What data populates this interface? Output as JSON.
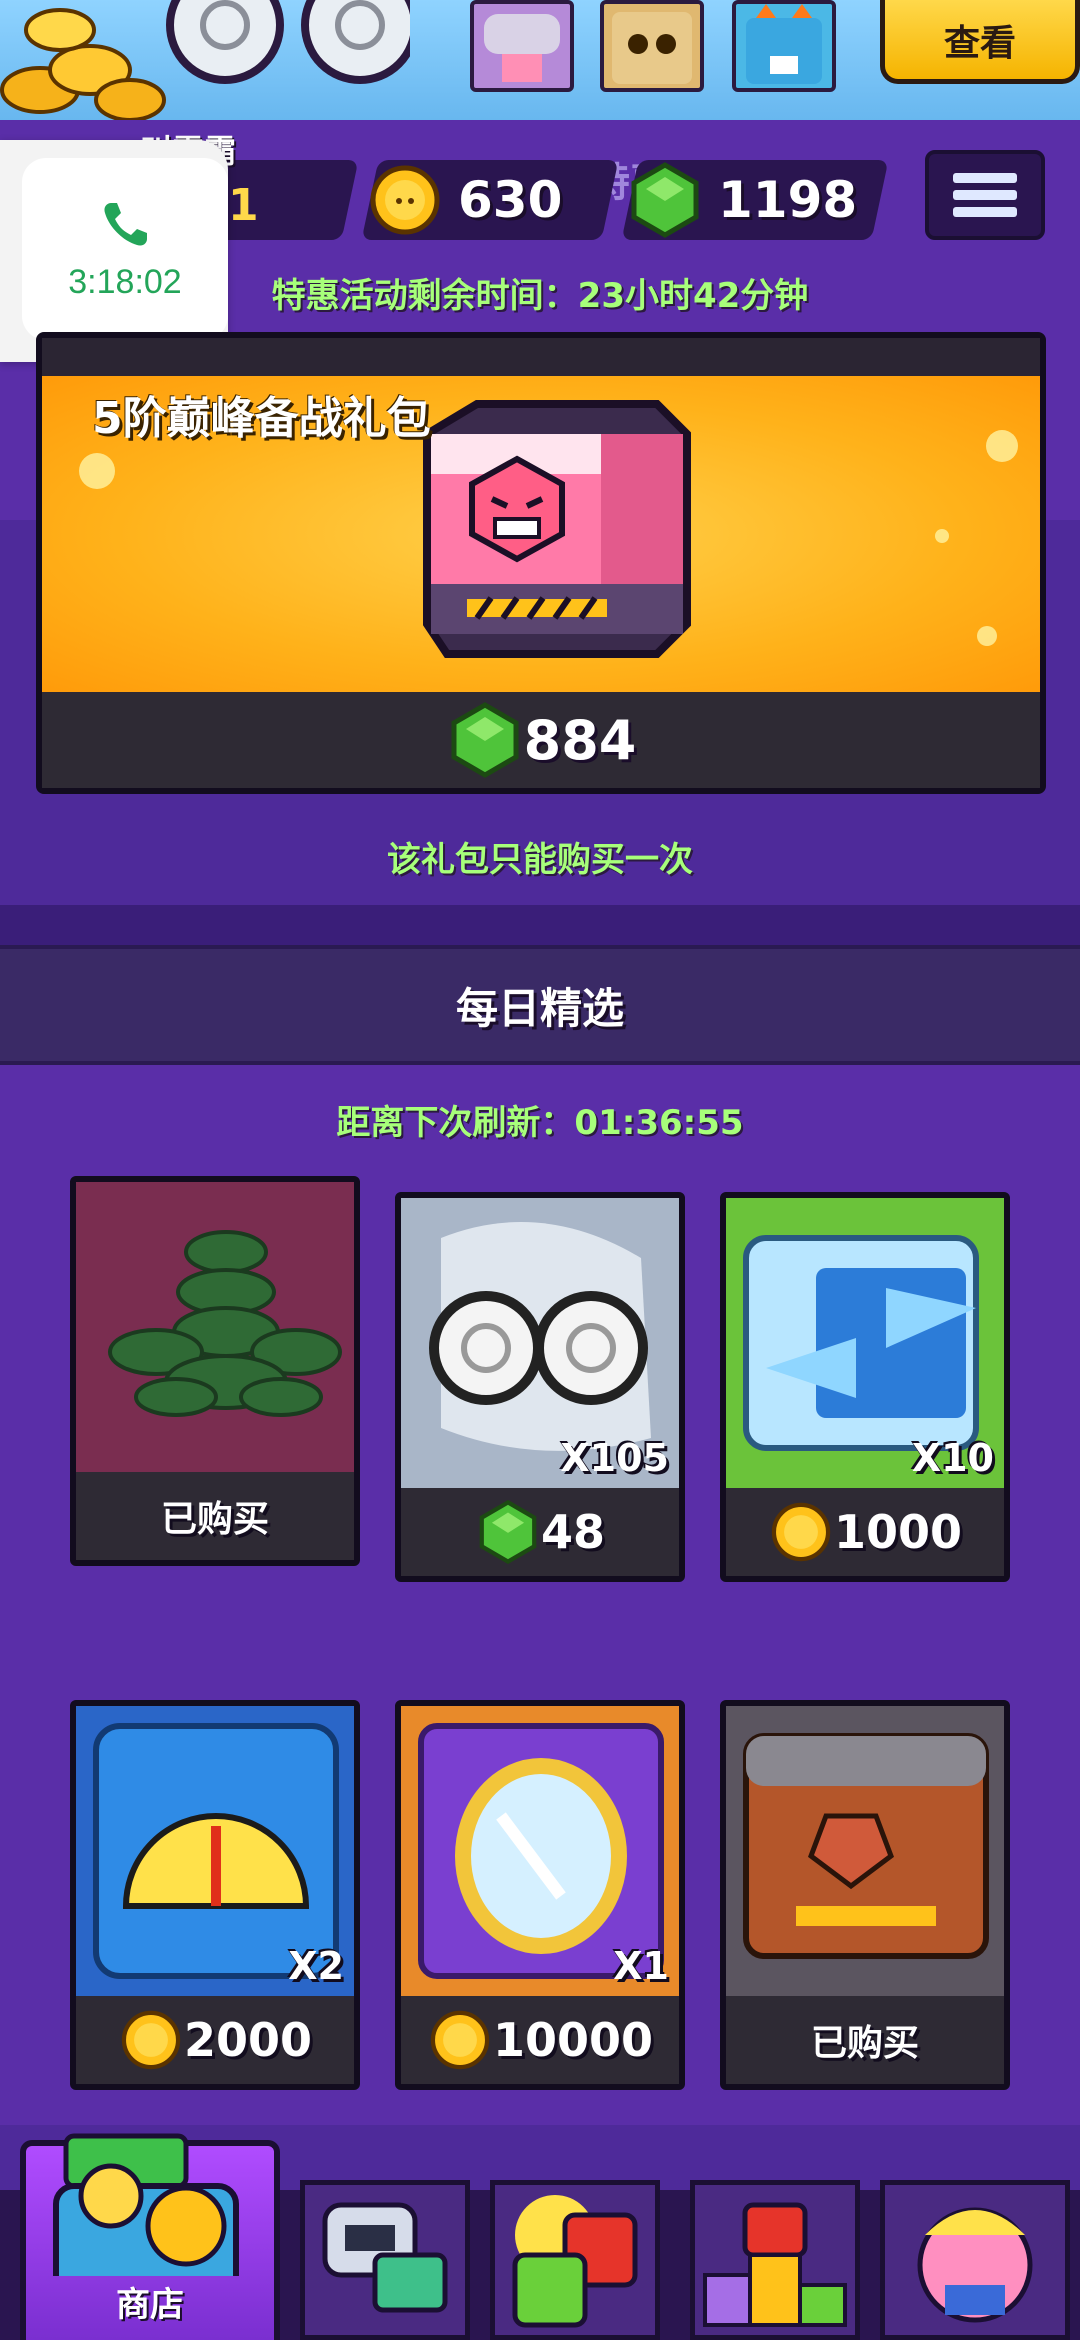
{
  "header": {
    "view_button": "查看",
    "player_name_fragment": "叫霸霸",
    "level_fragment": "1",
    "arena_title_fragment": "竞技场进阶特惠"
  },
  "currency": {
    "coins": "630",
    "gems": "1198"
  },
  "call_overlay": {
    "duration": "3:18:02"
  },
  "special_offer": {
    "timer_text": "特惠活动剩余时间：23小时42分钟",
    "pack_name": "5阶巅峰备战礼包",
    "price": "884",
    "note": "该礼包只能购买一次"
  },
  "daily_selection": {
    "title": "每日精选",
    "refresh_text": "距离下次刷新：01:36:55",
    "items": [
      {
        "kind": "gems-pile",
        "quantity": "",
        "price": "已购买",
        "currency": "none",
        "purchased": true
      },
      {
        "kind": "hypno-hero",
        "quantity": "X105",
        "price": "48",
        "currency": "gem",
        "purchased": false
      },
      {
        "kind": "swap-cube",
        "quantity": "X10",
        "price": "1000",
        "currency": "coin",
        "purchased": false
      },
      {
        "kind": "speed-gauge",
        "quantity": "X2",
        "price": "2000",
        "currency": "coin",
        "purchased": false
      },
      {
        "kind": "mirror-cube",
        "quantity": "X1",
        "price": "10000",
        "currency": "coin",
        "purchased": false
      },
      {
        "kind": "brown-chest",
        "quantity": "",
        "price": "已购买",
        "currency": "none",
        "purchased": true
      }
    ]
  },
  "bottom_nav": {
    "shop_label": "商店"
  },
  "colors": {
    "background_purple": "#5a2ea8",
    "pack_gold": "#ffb21a",
    "accent_green": "#a7ff7a",
    "button_yellow": "#ffd84a"
  }
}
